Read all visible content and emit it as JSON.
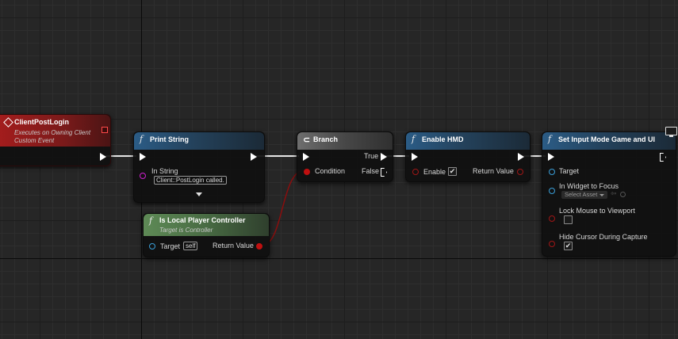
{
  "nodes": {
    "client_post_login": {
      "title": "ClientPostLogin",
      "subtitle_1": "Executes on Owning Client",
      "subtitle_2": "Custom Event"
    },
    "print_string": {
      "title": "Print String",
      "in_string_label": "In String",
      "in_string_value": "Client::PostLogin called."
    },
    "is_local_player_controller": {
      "title": "Is Local Player Controller",
      "subtitle": "Target is Controller",
      "target_label": "Target",
      "target_value": "self",
      "return_label": "Return Value"
    },
    "branch": {
      "title": "Branch",
      "true_label": "True",
      "false_label": "False",
      "condition_label": "Condition"
    },
    "enable_hmd": {
      "title": "Enable HMD",
      "enable_label": "Enable",
      "enable_checked": true,
      "return_label": "Return Value"
    },
    "set_input_mode": {
      "title": "Set Input Mode Game and UI",
      "target_label": "Target",
      "widget_label": "In Widget to Focus",
      "widget_value": "Select Asset",
      "lock_mouse_label": "Lock Mouse to Viewport",
      "lock_mouse_checked": false,
      "hide_cursor_label": "Hide Cursor During Capture",
      "hide_cursor_checked": true
    }
  },
  "icons": {
    "function": "f",
    "checkmark": "✔"
  },
  "colors": {
    "exec_pin": "#ffffff",
    "object_pin": "#3a9ed8",
    "bool_pin": "#a01616",
    "string_pin": "#d020d0",
    "function_header": "#2b5c86",
    "event_header": "#a61d1d",
    "pure_header": "#5e8a56"
  }
}
